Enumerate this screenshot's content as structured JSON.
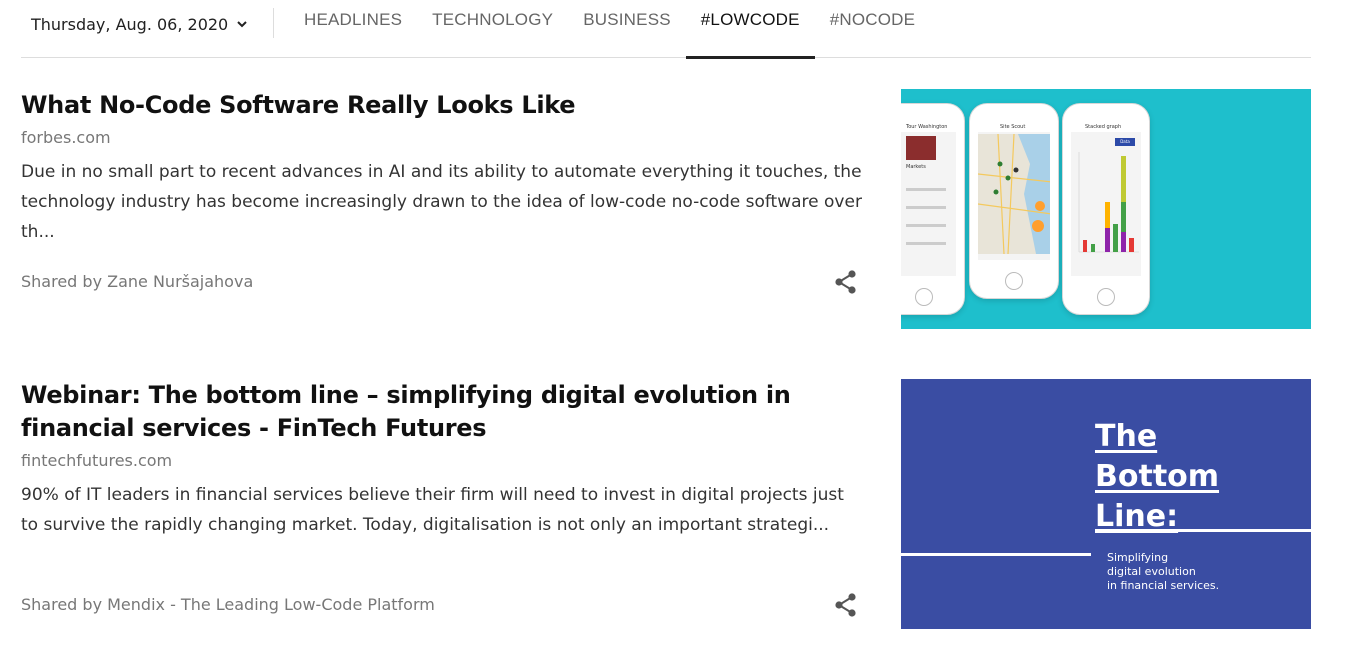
{
  "header": {
    "date": "Thursday, Aug. 06, 2020",
    "tabs": [
      {
        "label": "HEADLINES",
        "active": false
      },
      {
        "label": "TECHNOLOGY",
        "active": false
      },
      {
        "label": "BUSINESS",
        "active": false
      },
      {
        "label": "#LOWCODE",
        "active": true
      },
      {
        "label": "#NOCODE",
        "active": false
      }
    ]
  },
  "articles": [
    {
      "title": "What No-Code Software Really Looks Like",
      "source": "forbes.com",
      "summary": "Due in no small part to recent advances in AI and its ability to automate everything it touches, the technology industry has become increasingly drawn to the idea of low-code no-code software over th...",
      "shared_by": "Shared by Zane Nuršajahova",
      "thumbnail": {
        "phone_left_title": "Tour Washington",
        "phone_left_section": "Markets",
        "phone_middle_title": "Site Scout",
        "phone_right_title": "Stacked graph",
        "phone_right_button": "Data"
      }
    },
    {
      "title": "Webinar: The bottom line – simplifying digital evolution in financial services - FinTech Futures",
      "source": "fintechfutures.com",
      "summary": "90% of IT leaders in financial services believe their firm will need to invest in digital projects just to survive the rapidly changing market. Today, digitalisation is not only an important strategi...",
      "shared_by": "Shared by Mendix - The Leading Low-Code Platform",
      "thumbnail": {
        "heading_lines": [
          "The",
          "Bottom",
          "Line:"
        ],
        "subtitle_lines": [
          "Simplifying",
          "digital evolution",
          "in financial services."
        ]
      }
    }
  ],
  "colors": {
    "thumb1_bg": "#1ebfcc",
    "thumb2_bg": "#3a4da3",
    "active_tab_underline": "#222222"
  }
}
